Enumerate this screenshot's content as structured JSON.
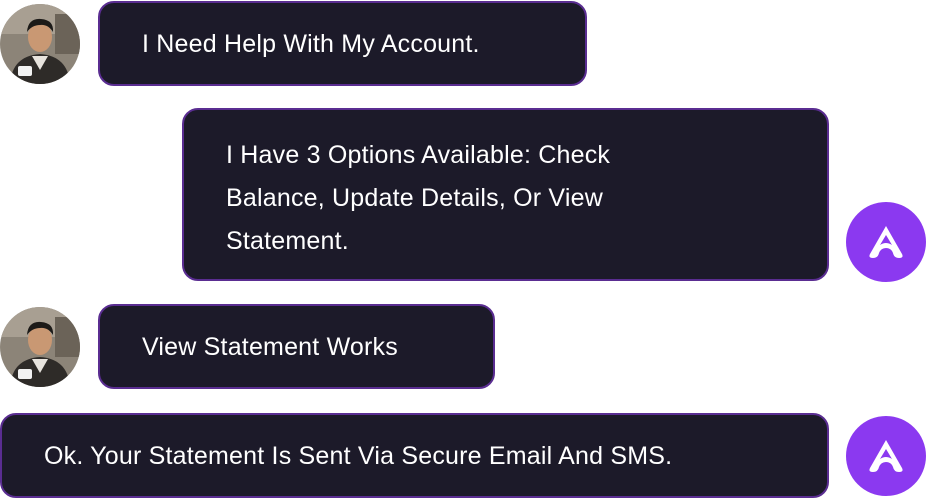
{
  "messages": [
    {
      "sender": "user",
      "text": "I Need Help With My Account."
    },
    {
      "sender": "bot",
      "text": "I Have 3 Options Available: Check\nBalance, Update Details, Or View\nStatement."
    },
    {
      "sender": "user",
      "text": "View Statement Works"
    },
    {
      "sender": "bot",
      "text": "Ok. Your Statement Is Sent Via Secure Email And SMS."
    }
  ],
  "colors": {
    "bubble_background": "#1c1a29",
    "bubble_border": "#5a2d91",
    "bot_avatar": "#8b39f0",
    "text": "#ffffff"
  },
  "icons": {
    "user_avatar": "user-photo-avatar",
    "bot_avatar": "bot-logo-icon"
  }
}
